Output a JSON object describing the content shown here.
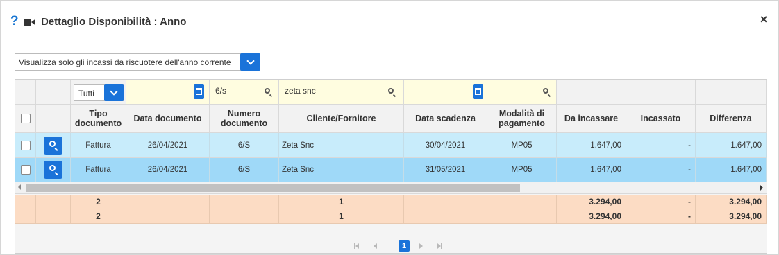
{
  "dialog": {
    "title": "Dettaglio Disponibilità : Anno",
    "help_icon": "?",
    "close_icon": "×"
  },
  "filter": {
    "selected": "Visualizza solo gli incassi da riscuotere dell'anno corrente"
  },
  "column_filters": {
    "tipo_documento": "Tutti",
    "numero_documento": "6/s",
    "cliente_fornitore": "zeta snc"
  },
  "columns": {
    "tipo_documento": "Tipo documento",
    "data_documento": "Data documento",
    "numero_documento": "Numero documento",
    "cliente_fornitore": "Cliente/Fornitore",
    "data_scadenza": "Data scadenza",
    "modalita_pagamento": "Modalità di pagamento",
    "da_incassare": "Da incassare",
    "incassato": "Incassato",
    "differenza": "Differenza"
  },
  "rows": [
    {
      "tipo_documento": "Fattura",
      "data_documento": "26/04/2021",
      "numero_documento": "6/S",
      "cliente_fornitore": "Zeta Snc",
      "data_scadenza": "30/04/2021",
      "modalita_pagamento": "MP05",
      "da_incassare": "1.647,00",
      "incassato": "-",
      "differenza": "1.647,00"
    },
    {
      "tipo_documento": "Fattura",
      "data_documento": "26/04/2021",
      "numero_documento": "6/S",
      "cliente_fornitore": "Zeta Snc",
      "data_scadenza": "31/05/2021",
      "modalita_pagamento": "MP05",
      "da_incassare": "1.647,00",
      "incassato": "-",
      "differenza": "1.647,00"
    }
  ],
  "totals": [
    {
      "tipo_documento": "2",
      "cliente_fornitore": "1",
      "da_incassare": "3.294,00",
      "incassato": "-",
      "differenza": "3.294,00"
    },
    {
      "tipo_documento": "2",
      "cliente_fornitore": "1",
      "da_incassare": "3.294,00",
      "incassato": "-",
      "differenza": "3.294,00"
    }
  ],
  "pager": {
    "current_page": "1"
  },
  "colors": {
    "accent": "#1a73d9",
    "row_light": "#c8ecfb",
    "row_selected": "#9fd9f8",
    "totals": "#fcdcc4",
    "filter_date": "#fffde0"
  }
}
